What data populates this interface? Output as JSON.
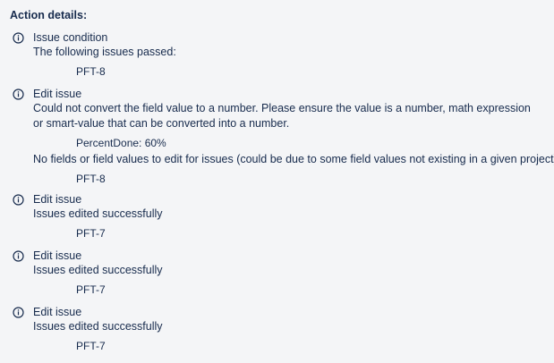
{
  "heading": "Action details:",
  "entries": [
    {
      "title": "Issue condition",
      "message": "The following issues passed:",
      "item": "PFT-8"
    },
    {
      "title": "Edit issue",
      "message": "Could not convert the field value to a number. Please ensure the value is a number, math expression or smart-value that can be converted into a number.",
      "item": "PercentDone: 60%",
      "message2": "No fields or field values to edit for issues (could be due to some field values not existing in a given project):",
      "item2": "PFT-8"
    },
    {
      "title": "Edit issue",
      "message": "Issues edited successfully",
      "item": "PFT-7"
    },
    {
      "title": "Edit issue",
      "message": "Issues edited successfully",
      "item": "PFT-7"
    },
    {
      "title": "Edit issue",
      "message": "Issues edited successfully",
      "item": "PFT-7"
    }
  ]
}
